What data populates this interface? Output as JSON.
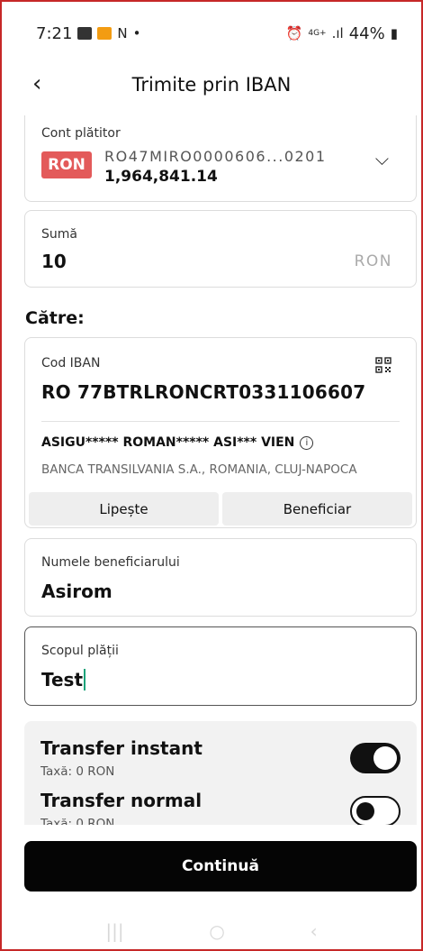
{
  "status_bar": {
    "time": "7:21",
    "left_icons": [
      "image-icon",
      "app-notification-icon",
      "n-icon",
      "dot"
    ],
    "extra_symbol": "N",
    "dot": "•",
    "network": "4G+",
    "signal": ".ıl",
    "battery": "44%"
  },
  "header": {
    "back_icon": "‹",
    "title": "Trimite prin IBAN"
  },
  "payer": {
    "label": "Cont plătitor",
    "currency_badge": "RON",
    "account": "RO47MIRO0000606...0201",
    "balance": "1,964,841.14"
  },
  "amount": {
    "label": "Sumă",
    "value": "10",
    "currency": "RON"
  },
  "to_section": {
    "heading": "Către:"
  },
  "beneficiary": {
    "iban_label": "Cod IBAN",
    "iban": "RO 77BTRLRONCRT0331106607",
    "name_masked": "ASIGU***** ROMAN***** ASI*** VIEN",
    "info_icon": "i",
    "bank": "BANCA TRANSILVANIA S.A., ROMANIA, CLUJ-NAPOCA",
    "paste_label": "Lipește",
    "beneficiary_label": "Beneficiar"
  },
  "beneficiary_name": {
    "label": "Numele beneficiarului",
    "value": "Asirom"
  },
  "purpose": {
    "label": "Scopul plății",
    "value": "Test"
  },
  "transfer_options": {
    "instant": {
      "title": "Transfer instant",
      "fee": "Taxă: 0 RON",
      "enabled": true
    },
    "normal": {
      "title": "Transfer normal",
      "fee": "Taxă: 0 RON",
      "enabled": false
    }
  },
  "continue_label": "Continuă",
  "nav": {
    "recent": "|||",
    "home": "○",
    "back": "‹"
  },
  "colors": {
    "badge": "#e35a5a",
    "caret": "#1aa37a",
    "button": "#050505",
    "frame": "#c62828"
  }
}
